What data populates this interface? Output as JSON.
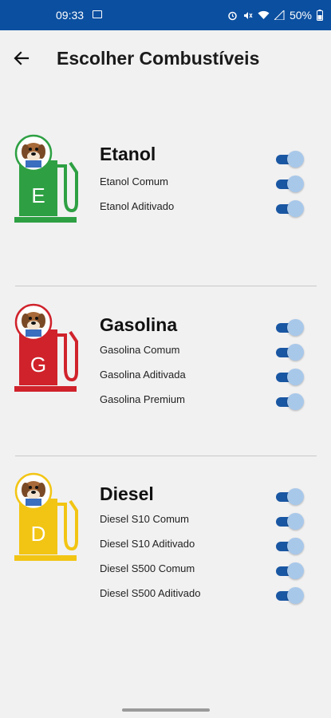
{
  "status_bar": {
    "time": "09:33",
    "battery": "50%"
  },
  "header": {
    "title": "Escolher Combustíveis"
  },
  "sections": [
    {
      "title": "Etanol",
      "letter": "E",
      "color": "#2ea043",
      "options": [
        {
          "label": "Etanol Comum",
          "enabled": true
        },
        {
          "label": "Etanol Aditivado",
          "enabled": true
        }
      ]
    },
    {
      "title": "Gasolina",
      "letter": "G",
      "color": "#d0222b",
      "options": [
        {
          "label": "Gasolina Comum",
          "enabled": true
        },
        {
          "label": "Gasolina Aditivada",
          "enabled": true
        },
        {
          "label": "Gasolina Premium",
          "enabled": true
        }
      ]
    },
    {
      "title": "Diesel",
      "letter": "D",
      "color": "#f2c514",
      "options": [
        {
          "label": "Diesel S10 Comum",
          "enabled": true
        },
        {
          "label": "Diesel S10 Aditivado",
          "enabled": true
        },
        {
          "label": "Diesel S500 Comum",
          "enabled": true
        },
        {
          "label": "Diesel S500 Aditivado",
          "enabled": true
        }
      ]
    }
  ]
}
